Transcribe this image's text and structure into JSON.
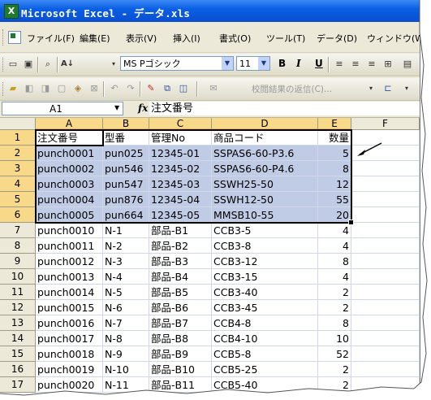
{
  "window": {
    "title": "Microsoft Excel - データ.xls",
    "app_icon": "excel-icon"
  },
  "menubar": {
    "items": [
      "ファイル(F)",
      "編集(E)",
      "表示(V)",
      "挿入(I)",
      "書式(O)",
      "ツール(T)",
      "データ(D)",
      "ウィンドウ(W)"
    ]
  },
  "toolbar": {
    "font_name": "MS Pゴシック",
    "font_size": "11",
    "bold_label": "B",
    "italic_label": "I",
    "underline_label": "U",
    "reply_text": "校閲結果の返信(C)..."
  },
  "formula_bar": {
    "name_box": "A1",
    "fx_label": "fx",
    "content": "注文番号"
  },
  "sheet": {
    "columns": [
      "A",
      "B",
      "C",
      "D",
      "E",
      "F"
    ],
    "selected_columns": [
      "A",
      "B",
      "C",
      "D",
      "E"
    ],
    "rows": [
      {
        "num": "1",
        "cells": [
          "注文番号",
          "型番",
          "管理No",
          "商品コード",
          "数量"
        ]
      },
      {
        "num": "2",
        "cells": [
          "punch0001",
          "pun025",
          "12345-01",
          "SSPAS6-60-P3.6",
          "5"
        ]
      },
      {
        "num": "3",
        "cells": [
          "punch0002",
          "pun546",
          "12345-02",
          "SSPAS6-60-P4.6",
          "8"
        ]
      },
      {
        "num": "4",
        "cells": [
          "punch0003",
          "pun547",
          "12345-03",
          "SSWH25-50",
          "12"
        ]
      },
      {
        "num": "5",
        "cells": [
          "punch0004",
          "pun876",
          "12345-04",
          "SSWH12-50",
          "55"
        ]
      },
      {
        "num": "6",
        "cells": [
          "punch0005",
          "pun664",
          "12345-05",
          "MMSB10-55",
          "20"
        ]
      },
      {
        "num": "7",
        "cells": [
          "punch0010",
          "N-1",
          "部品-B1",
          "CCB3-5",
          "4"
        ]
      },
      {
        "num": "8",
        "cells": [
          "punch0011",
          "N-2",
          "部品-B2",
          "CCB3-8",
          "4"
        ]
      },
      {
        "num": "9",
        "cells": [
          "punch0012",
          "N-3",
          "部品-B3",
          "CCB3-12",
          "8"
        ]
      },
      {
        "num": "10",
        "cells": [
          "punch0013",
          "N-4",
          "部品-B4",
          "CCB3-15",
          "4"
        ]
      },
      {
        "num": "11",
        "cells": [
          "punch0014",
          "N-5",
          "部品-B5",
          "CCB3-40",
          "2"
        ]
      },
      {
        "num": "12",
        "cells": [
          "punch0015",
          "N-6",
          "部品-B6",
          "CCB3-45",
          "2"
        ]
      },
      {
        "num": "13",
        "cells": [
          "punch0016",
          "N-7",
          "部品-B7",
          "CCB4-8",
          "8"
        ]
      },
      {
        "num": "14",
        "cells": [
          "punch0017",
          "N-8",
          "部品-B8",
          "CCB4-10",
          "10"
        ]
      },
      {
        "num": "15",
        "cells": [
          "punch0018",
          "N-9",
          "部品-B9",
          "CCB5-8",
          "52"
        ]
      },
      {
        "num": "16",
        "cells": [
          "punch0019",
          "N-10",
          "部品-B10",
          "CCB5-25",
          "2"
        ]
      },
      {
        "num": "17",
        "cells": [
          "punch0020",
          "N-11",
          "部品-B11",
          "CCB5-40",
          "2"
        ]
      }
    ]
  },
  "colors": {
    "title_bar": "#0a5fe3",
    "selection_fill": "#c0cce6",
    "header_highlight": "#f8d98a",
    "chrome": "#ece9d8"
  }
}
